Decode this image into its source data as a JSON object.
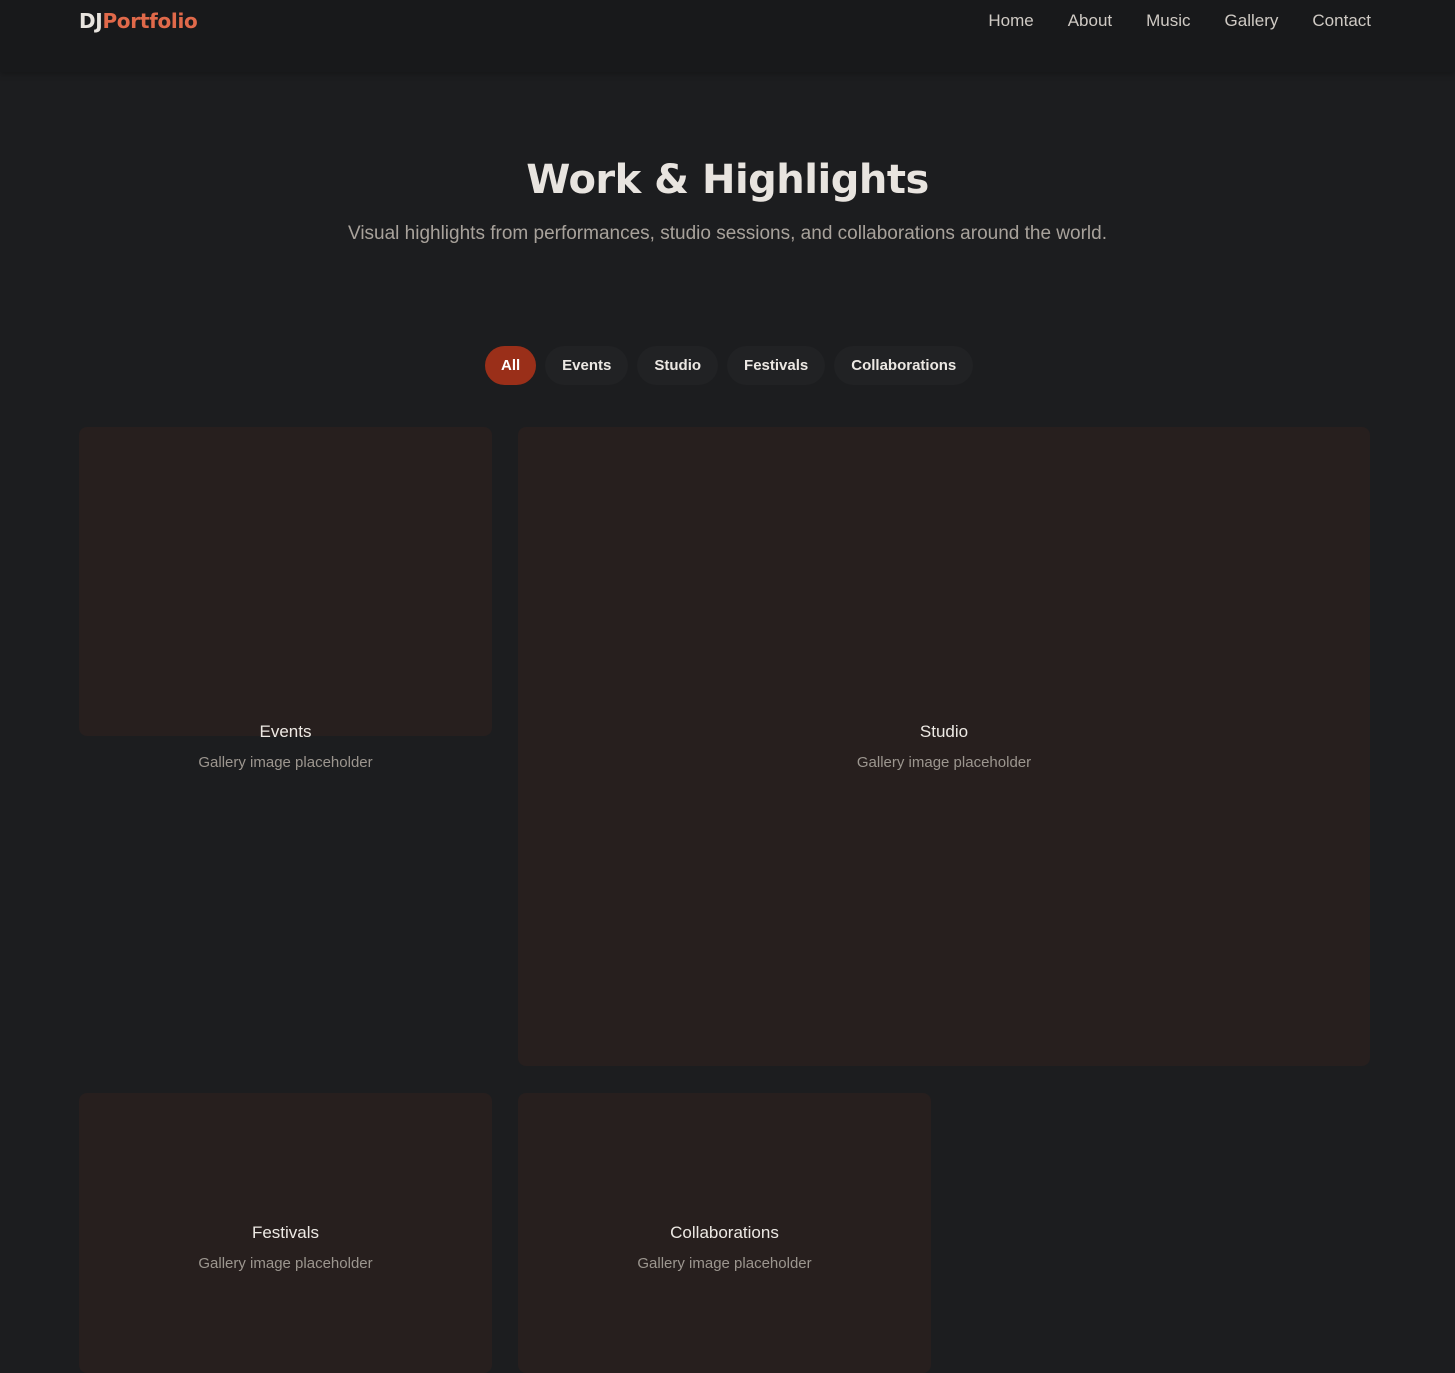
{
  "nav": {
    "logo_prefix": "DJ",
    "logo_accent": "Portfolio",
    "links": [
      "Home",
      "About",
      "Music",
      "Gallery",
      "Contact"
    ]
  },
  "hero": {
    "title": "Work & Highlights",
    "subtitle": "Visual highlights from performances, studio sessions, and collaborations around the world."
  },
  "filters": {
    "active": "All",
    "items": [
      "All",
      "Events",
      "Studio",
      "Festivals",
      "Collaborations"
    ]
  },
  "gallery": {
    "items": [
      {
        "title": "Events",
        "caption": "Gallery image placeholder"
      },
      {
        "title": "Studio",
        "caption": "Gallery image placeholder"
      },
      {
        "title": "Festivals",
        "caption": "Gallery image placeholder"
      },
      {
        "title": "Collaborations",
        "caption": "Gallery image placeholder"
      }
    ]
  },
  "colors": {
    "background": "#1c1d1f",
    "accent": "#e0694a",
    "active_pill": "#9a2f19",
    "tile": "#271f1e"
  }
}
